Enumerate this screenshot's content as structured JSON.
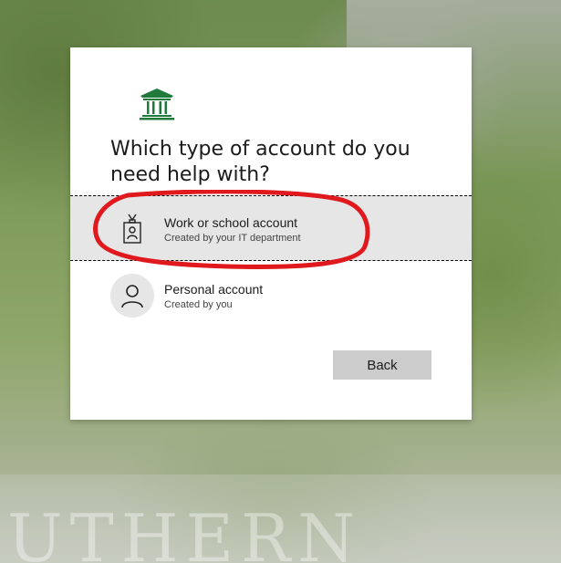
{
  "dialog": {
    "title": "Which type of account do you need help with?",
    "back_label": "Back"
  },
  "options": [
    {
      "name": "Work or school account",
      "subtitle": "Created by your IT department",
      "icon": "badge-icon",
      "selected": true
    },
    {
      "name": "Personal account",
      "subtitle": "Created by you",
      "icon": "person-icon",
      "selected": false
    }
  ],
  "background": {
    "sign_text": "UTHERN"
  },
  "colors": {
    "logo_green": "#1f7a3c",
    "annotation_red": "#e0191e",
    "selected_bg": "#e6e6e6",
    "button_bg": "#cccccc"
  }
}
